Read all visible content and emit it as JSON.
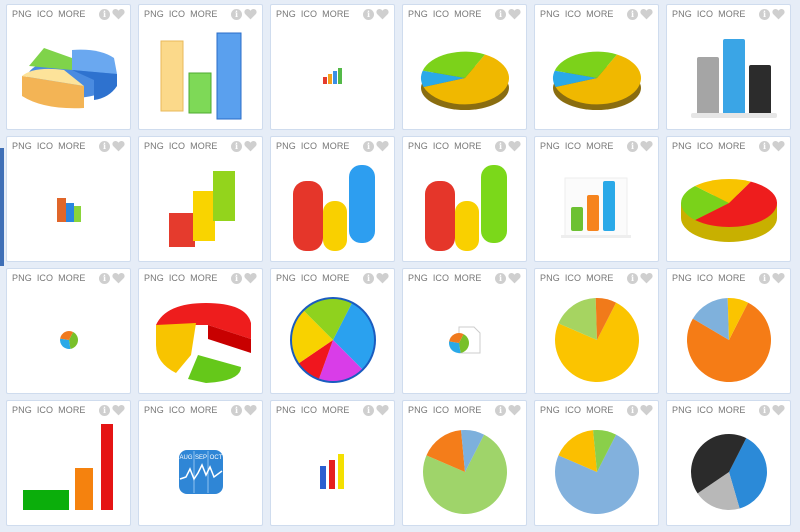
{
  "tile_labels": {
    "png": "PNG",
    "ico": "ICO",
    "more": "MORE"
  },
  "tiles": [
    {
      "icon": "3d-pie-chart-pastel-icon"
    },
    {
      "icon": "3d-bar-chart-pastel-icon"
    },
    {
      "icon": "small-bar-chart-icon"
    },
    {
      "icon": "glossy-pie-chart-yellow-green-blue-icon"
    },
    {
      "icon": "glossy-pie-chart-yellow-green-blue-icon"
    },
    {
      "icon": "bar-chart-gray-blue-black-icon"
    },
    {
      "icon": "small-3d-bar-chart-icon"
    },
    {
      "icon": "3d-cube-bar-chart-icon"
    },
    {
      "icon": "rounded-bar-chart-red-yellow-blue-icon"
    },
    {
      "icon": "rounded-bar-chart-red-yellow-green-icon"
    },
    {
      "icon": "bar-chart-document-icon"
    },
    {
      "icon": "3d-pie-chart-red-green-yellow-icon"
    },
    {
      "icon": "small-pie-chart-icon"
    },
    {
      "icon": "exploded-pie-chart-icon"
    },
    {
      "icon": "rainbow-pie-chart-icon"
    },
    {
      "icon": "pie-chart-file-icon"
    },
    {
      "icon": "pie-chart-yellow-icon"
    },
    {
      "icon": "pie-chart-orange-icon"
    },
    {
      "icon": "bar-chart-green-orange-red-icon"
    },
    {
      "icon": "stocks-app-icon",
      "months": [
        "AUG",
        "SEP",
        "OCT"
      ]
    },
    {
      "icon": "small-bar-chart-blue-red-yellow-icon"
    },
    {
      "icon": "pie-chart-green-icon"
    },
    {
      "icon": "pie-chart-blue-icon"
    },
    {
      "icon": "pie-chart-dark-icon"
    }
  ]
}
